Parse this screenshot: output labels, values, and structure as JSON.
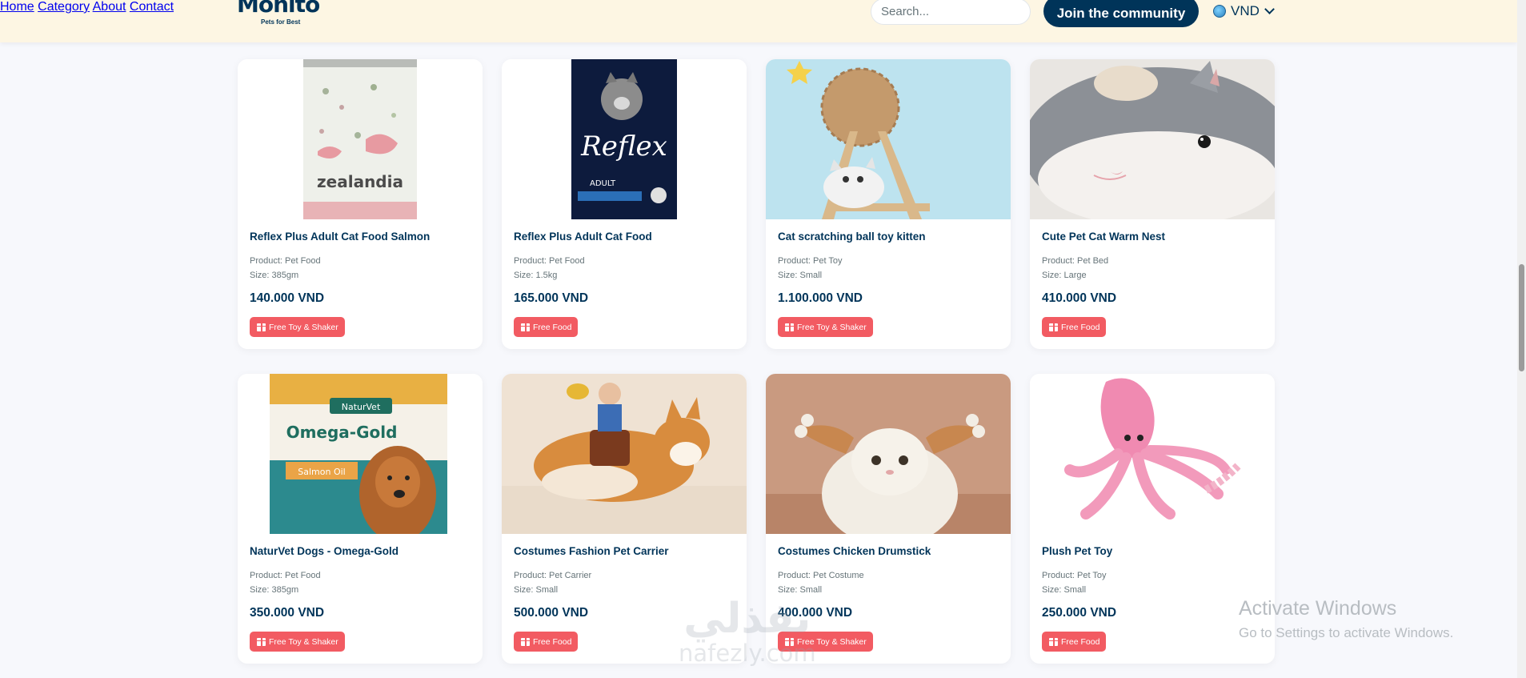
{
  "header": {
    "logo": {
      "name": "Monito",
      "tagline": "Pets for Best"
    },
    "nav": [
      "Home",
      "Category",
      "About",
      "Contact"
    ],
    "search_placeholder": "Search...",
    "join_label": "Join the community",
    "currency": "VND"
  },
  "products": [
    {
      "title": "Reflex Plus Adult Cat Food Salmon",
      "product": "Product: Pet Food",
      "size": "Size: 385gm",
      "price": "140.000 VND",
      "gift": "Free Toy & Shaker",
      "image": "zealandia-can"
    },
    {
      "title": "Reflex Plus Adult Cat Food",
      "product": "Product: Pet Food",
      "size": "Size: 1.5kg",
      "price": "165.000 VND",
      "gift": "Free Food",
      "image": "reflex-bag"
    },
    {
      "title": "Cat scratching ball toy kitten",
      "product": "Product: Pet Toy",
      "size": "Size: Small",
      "price": "1.100.000 VND",
      "gift": "Free Toy & Shaker",
      "image": "scratch-ball"
    },
    {
      "title": "Cute Pet Cat Warm Nest",
      "product": "Product: Pet Bed",
      "size": "Size: Large",
      "price": "410.000 VND",
      "gift": "Free Food",
      "image": "shark-nest"
    },
    {
      "title": "NaturVet Dogs - Omega-Gold",
      "product": "Product: Pet Food",
      "size": "Size: 385gm",
      "price": "350.000 VND",
      "gift": "Free Toy & Shaker",
      "image": "omega-gold"
    },
    {
      "title": "Costumes Fashion Pet Carrier",
      "product": "Product: Pet Carrier",
      "size": "Size: Small",
      "price": "500.000 VND",
      "gift": "Free Food",
      "image": "corgi-rider"
    },
    {
      "title": "Costumes Chicken Drumstick",
      "product": "Product: Pet Costume",
      "size": "Size: Small",
      "price": "400.000 VND",
      "gift": "Free Toy & Shaker",
      "image": "chicken-cat"
    },
    {
      "title": "Plush Pet Toy",
      "product": "Product: Pet Toy",
      "size": "Size: Small",
      "price": "250.000 VND",
      "gift": "Free Food",
      "image": "octopus-plush"
    }
  ],
  "watermarks": {
    "activate_title": "Activate Windows",
    "activate_sub": "Go to Settings to activate Windows.",
    "site_arabic": "نفذلي",
    "site_latin": "nafezly.com"
  },
  "colors": {
    "primary": "#003459",
    "accent": "#f25b62",
    "header_bg": "#fdf6e3",
    "page_bg": "#f7f8fc"
  }
}
